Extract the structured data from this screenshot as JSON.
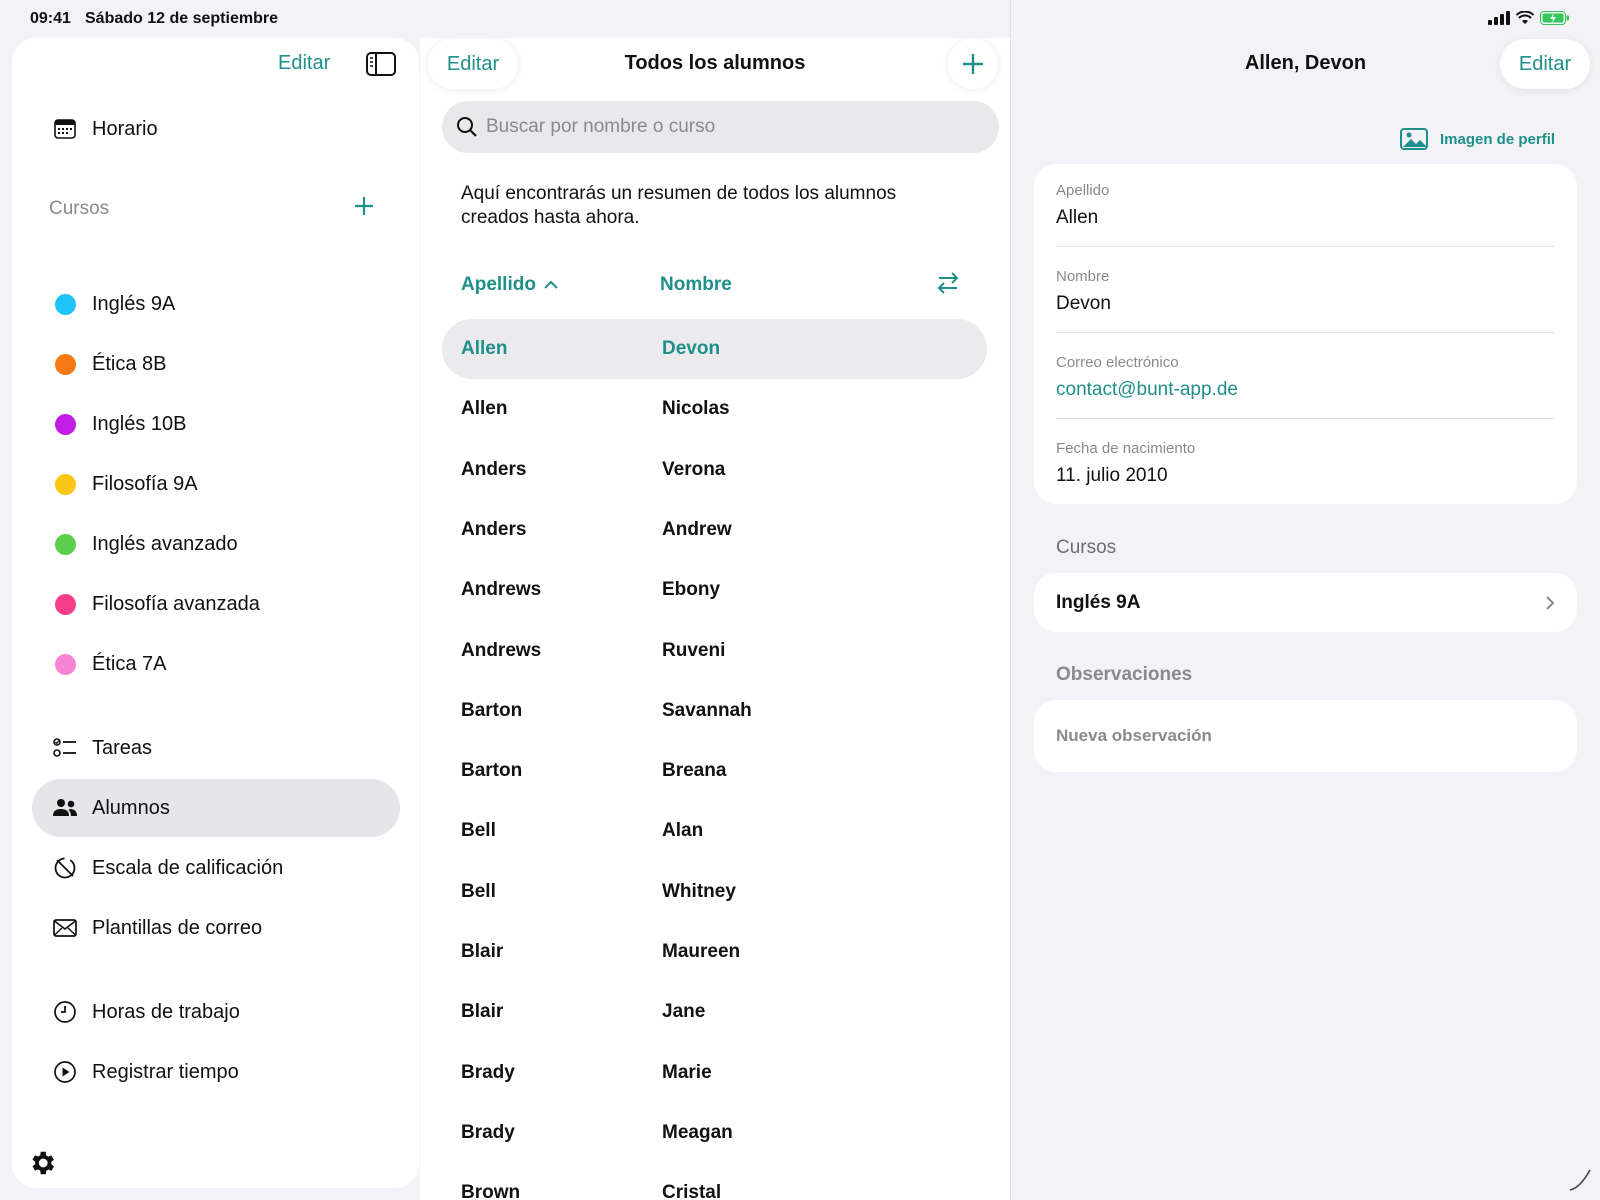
{
  "status": {
    "time": "09:41",
    "date": "Sábado 12 de septiembre"
  },
  "sidebar": {
    "edit_label": "Editar",
    "schedule_label": "Horario",
    "courses_title": "Cursos",
    "courses": [
      {
        "label": "Inglés 9A",
        "color": "#1ec4f7"
      },
      {
        "label": "Ética 8B",
        "color": "#f57a14"
      },
      {
        "label": "Inglés 10B",
        "color": "#c21ee8"
      },
      {
        "label": "Filosofía 9A",
        "color": "#fcc614"
      },
      {
        "label": "Inglés avanzado",
        "color": "#5cd04c"
      },
      {
        "label": "Filosofía avanzada",
        "color": "#f53d8c"
      },
      {
        "label": "Ética 7A",
        "color": "#f784d3"
      }
    ],
    "nav": [
      {
        "label": "Tareas",
        "icon": "checklist-icon"
      },
      {
        "label": "Alumnos",
        "icon": "people-icon",
        "active": true
      },
      {
        "label": "Escala de calificación",
        "icon": "grading-scale-icon"
      },
      {
        "label": "Plantillas de correo",
        "icon": "envelope-icon"
      },
      {
        "label": "Horas de trabajo",
        "icon": "clock-icon"
      },
      {
        "label": "Registrar tiempo",
        "icon": "play-circle-icon"
      }
    ]
  },
  "students": {
    "edit_label": "Editar",
    "title": "Todos los alumnos",
    "search_placeholder": "Buscar por nombre o curso",
    "description": "Aquí encontrarás un resumen de todos los alumnos creados hasta ahora.",
    "col_last": "Apellido",
    "col_first": "Nombre",
    "rows": [
      {
        "last": "Allen",
        "first": "Devon"
      },
      {
        "last": "Allen",
        "first": "Nicolas"
      },
      {
        "last": "Anders",
        "first": "Verona"
      },
      {
        "last": "Anders",
        "first": "Andrew"
      },
      {
        "last": "Andrews",
        "first": "Ebony"
      },
      {
        "last": "Andrews",
        "first": "Ruveni"
      },
      {
        "last": "Barton",
        "first": "Savannah"
      },
      {
        "last": "Barton",
        "first": "Breana"
      },
      {
        "last": "Bell",
        "first": "Alan"
      },
      {
        "last": "Bell",
        "first": "Whitney"
      },
      {
        "last": "Blair",
        "first": "Maureen"
      },
      {
        "last": "Blair",
        "first": "Jane"
      },
      {
        "last": "Brady",
        "first": "Marie"
      },
      {
        "last": "Brady",
        "first": "Meagan"
      },
      {
        "last": "Brown",
        "first": "Cristal"
      }
    ]
  },
  "detail": {
    "title": "Allen, Devon",
    "edit_label": "Editar",
    "profile_image_label": "Imagen de perfil",
    "fields": {
      "last_label": "Apellido",
      "last_value": "Allen",
      "first_label": "Nombre",
      "first_value": "Devon",
      "email_label": "Correo electrónico",
      "email_value": "contact@bunt-app.de",
      "birth_label": "Fecha de nacimiento",
      "birth_value": "11. julio 2010"
    },
    "courses_label": "Cursos",
    "course": "Inglés 9A",
    "notes_label": "Observaciones",
    "new_note": "Nueva observación"
  },
  "colors": {
    "accent": "#1f8f8a"
  }
}
